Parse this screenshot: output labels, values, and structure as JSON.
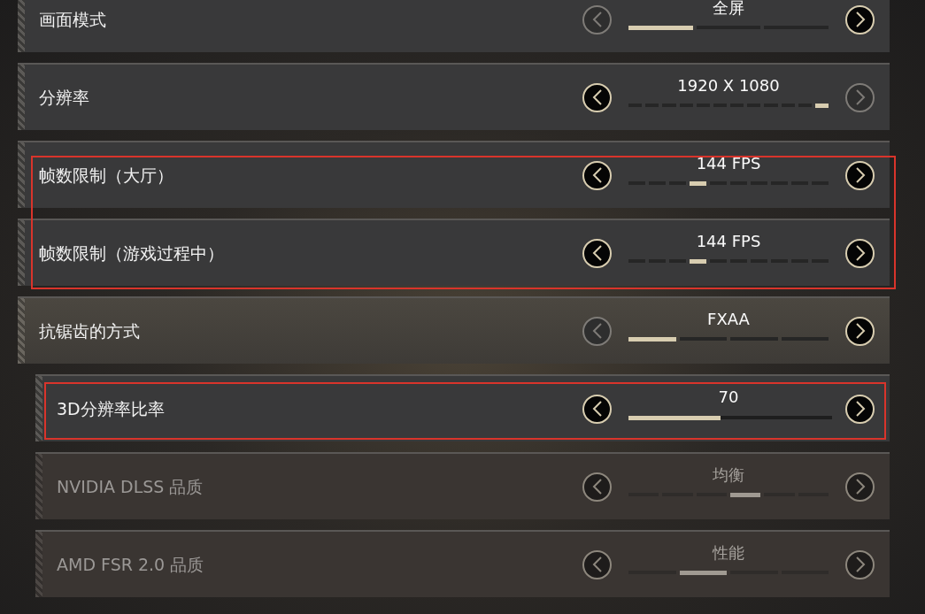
{
  "settings": [
    {
      "label": "画面模式",
      "value": "全屏",
      "kind": "segments",
      "disabled": false,
      "highlighted": false,
      "prev_enabled": false,
      "next_enabled": true,
      "segments": [
        {
          "selected": true
        },
        {
          "selected": false
        },
        {
          "selected": false
        }
      ]
    },
    {
      "label": "分辨率",
      "value": "1920 X 1080",
      "kind": "segments",
      "disabled": false,
      "highlighted": false,
      "prev_enabled": true,
      "next_enabled": false,
      "segments": [
        {
          "selected": false
        },
        {
          "selected": false
        },
        {
          "selected": false
        },
        {
          "selected": false
        },
        {
          "selected": false
        },
        {
          "selected": false
        },
        {
          "selected": false
        },
        {
          "selected": false
        },
        {
          "selected": false
        },
        {
          "selected": false
        },
        {
          "selected": false
        },
        {
          "selected": true
        }
      ]
    },
    {
      "label": "帧数限制（大厅）",
      "value": "144 FPS",
      "kind": "segments",
      "disabled": false,
      "highlighted": true,
      "prev_enabled": true,
      "next_enabled": true,
      "segments": [
        {
          "selected": false
        },
        {
          "selected": false
        },
        {
          "selected": false
        },
        {
          "selected": true
        },
        {
          "selected": false
        },
        {
          "selected": false
        },
        {
          "selected": false
        },
        {
          "selected": false
        },
        {
          "selected": false
        },
        {
          "selected": false
        }
      ]
    },
    {
      "label": "帧数限制（游戏过程中）",
      "value": "144 FPS",
      "kind": "segments",
      "disabled": false,
      "highlighted": true,
      "prev_enabled": true,
      "next_enabled": true,
      "segments": [
        {
          "selected": false
        },
        {
          "selected": false
        },
        {
          "selected": false
        },
        {
          "selected": true
        },
        {
          "selected": false
        },
        {
          "selected": false
        },
        {
          "selected": false
        },
        {
          "selected": false
        },
        {
          "selected": false
        },
        {
          "selected": false
        }
      ]
    },
    {
      "label": "抗锯齿的方式",
      "value": "FXAA",
      "kind": "segments",
      "disabled": false,
      "highlighted": false,
      "prev_enabled": false,
      "next_enabled": true,
      "segments": [
        {
          "selected": true
        },
        {
          "selected": false
        },
        {
          "selected": false
        },
        {
          "selected": false
        }
      ],
      "children": [
        {
          "label": "3D分辨率比率",
          "value": "70",
          "kind": "slider",
          "disabled": false,
          "highlighted": true,
          "prev_enabled": true,
          "next_enabled": true,
          "level": 0.45
        },
        {
          "label": "NVIDIA DLSS 品质",
          "value": "均衡",
          "kind": "segments",
          "disabled": true,
          "highlighted": false,
          "prev_enabled": true,
          "next_enabled": true,
          "segments": [
            {
              "selected": false
            },
            {
              "selected": false
            },
            {
              "selected": false
            },
            {
              "selected": true
            },
            {
              "selected": false
            },
            {
              "selected": false
            }
          ]
        },
        {
          "label": "AMD FSR 2.0 品质",
          "value": "性能",
          "kind": "segments",
          "disabled": true,
          "highlighted": false,
          "prev_enabled": false,
          "next_enabled": true,
          "segments": [
            {
              "selected": false
            },
            {
              "selected": true
            },
            {
              "selected": false
            },
            {
              "selected": false
            }
          ]
        }
      ]
    }
  ]
}
